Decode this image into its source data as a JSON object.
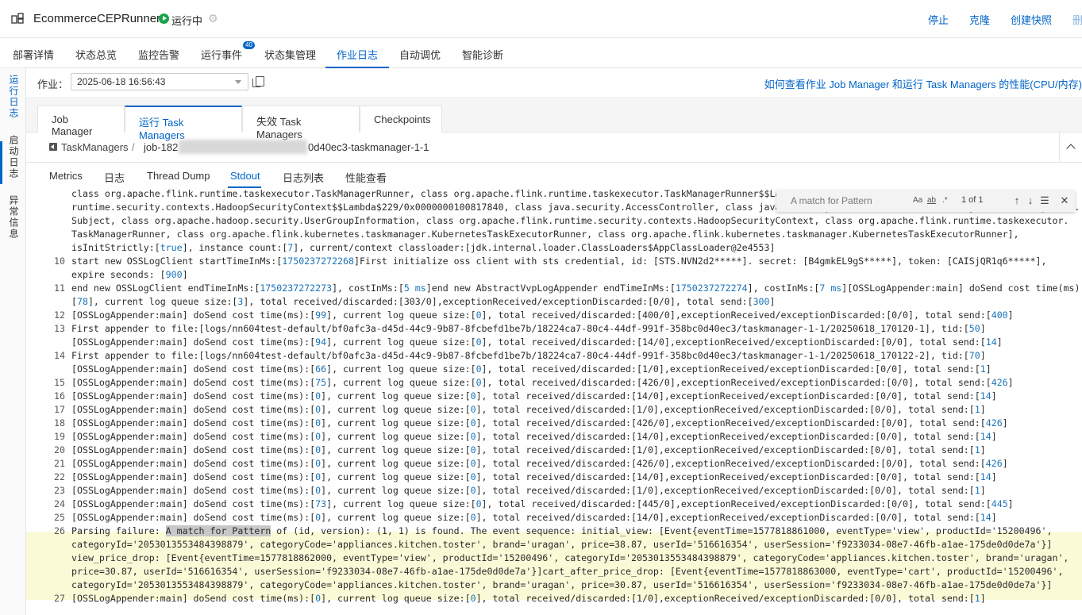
{
  "header": {
    "app_title": "EcommerceCEPRunner4",
    "status": "运行中",
    "actions": [
      "停止",
      "克隆",
      "创建快照",
      "删除"
    ]
  },
  "main_tabs": [
    {
      "label": "部署详情"
    },
    {
      "label": "状态总览"
    },
    {
      "label": "监控告警"
    },
    {
      "label": "运行事件",
      "badge": "40"
    },
    {
      "label": "状态集管理"
    },
    {
      "label": "作业日志",
      "active": true
    },
    {
      "label": "自动调优"
    },
    {
      "label": "智能诊断"
    }
  ],
  "left_nav": [
    {
      "label": "运行日志",
      "active": true
    },
    {
      "label": "启动日志"
    },
    {
      "label": "异常信息"
    }
  ],
  "job": {
    "label": "作业：",
    "selected": "2025-06-18 16:56:43",
    "help_link": "如何查看作业 Job Manager 和运行 Task Managers 的性能(CPU/内存)"
  },
  "sub_tabs": [
    "Job Manager",
    "运行 Task Managers",
    "失效 Task Managers",
    "Checkpoints"
  ],
  "breadcrumb": {
    "root": "TaskManagers",
    "separator": "/",
    "job_prefix": "job-182",
    "job_suffix": "0d40ec3-taskmanager-1-1"
  },
  "inner_tabs": [
    "Metrics",
    "日志",
    "Thread Dump",
    "Stdout",
    "日志列表",
    "性能查看"
  ],
  "find_widget": {
    "query": "A match for Pattern",
    "options": [
      "Aa",
      "ab",
      ".*"
    ],
    "count": "1 of 1"
  },
  "log_lines": [
    {
      "ln": "",
      "text": "class org.apache.flink.runtime.taskexecutor.TaskManagerRunner, class org.apache.flink.runtime.taskexecutor.TaskManagerRunner$$La"
    },
    {
      "ln": "",
      "text": "runtime.security.contexts.HadoopSecurityContext$$Lambda$229/0x0000000100817840, class java.security.AccessController, class java.security.AccessController, class javax.security.auth."
    },
    {
      "ln": "",
      "text": "Subject, class org.apache.hadoop.security.UserGroupInformation, class org.apache.flink.runtime.security.contexts.HadoopSecurityContext, class org.apache.flink.runtime.taskexecutor."
    },
    {
      "ln": "",
      "text": "TaskManagerRunner, class org.apache.flink.kubernetes.taskmanager.KubernetesTaskExecutorRunner, class org.apache.flink.kubernetes.taskmanager.KubernetesTaskExecutorRunner],"
    },
    {
      "ln": "",
      "text": "isInitStrictly:[true], instance count:[7], current/context classloader:[jdk.internal.loader.ClassLoaders$AppClassLoader@2e4553]"
    },
    {
      "ln": "10",
      "text": "start new OSSLogClient startTimeInMs:[1750237272268]First initialize oss client with sts credential, id: [STS.NVN2d2*****]. secret: [B4gmkEL9gS*****], token: [CAISjQR1q6*****],"
    },
    {
      "ln": "",
      "text": "expire seconds: [900]"
    },
    {
      "ln": "11",
      "text": "end new OSSLogClient endTimeInMs:[1750237272273], costInMs:[5 ms]end new AbstractVvpLogAppender endTimeInMs:[1750237272274], costInMs:[7 ms][OSSLogAppender:main] doSend cost time(ms):"
    },
    {
      "ln": "",
      "text": "[78], current log queue size:[3], total received/discarded:[303/0],exceptionReceived/exceptionDiscarded:[0/0], total send:[300]"
    },
    {
      "ln": "12",
      "text": "[OSSLogAppender:main] doSend cost time(ms):[99], current log queue size:[0], total received/discarded:[400/0],exceptionReceived/exceptionDiscarded:[0/0], total send:[400]"
    },
    {
      "ln": "13",
      "text": "First appender to file:[logs/nn604test-default/bf0afc3a-d45d-44c9-9b87-8fcbefd1be7b/18224ca7-80c4-44df-991f-358bc0d40ec3/taskmanager-1-1/20250618_170120-1], tid:[50]"
    },
    {
      "ln": "",
      "text": "[OSSLogAppender:main] doSend cost time(ms):[94], current log queue size:[0], total received/discarded:[14/0],exceptionReceived/exceptionDiscarded:[0/0], total send:[14]"
    },
    {
      "ln": "14",
      "text": "First appender to file:[logs/nn604test-default/bf0afc3a-d45d-44c9-9b87-8fcbefd1be7b/18224ca7-80c4-44df-991f-358bc0d40ec3/taskmanager-1-1/20250618_170122-2], tid:[70]"
    },
    {
      "ln": "",
      "text": "[OSSLogAppender:main] doSend cost time(ms):[66], current log queue size:[0], total received/discarded:[1/0],exceptionReceived/exceptionDiscarded:[0/0], total send:[1]"
    },
    {
      "ln": "15",
      "text": "[OSSLogAppender:main] doSend cost time(ms):[75], current log queue size:[0], total received/discarded:[426/0],exceptionReceived/exceptionDiscarded:[0/0], total send:[426]"
    },
    {
      "ln": "16",
      "text": "[OSSLogAppender:main] doSend cost time(ms):[0], current log queue size:[0], total received/discarded:[14/0],exceptionReceived/exceptionDiscarded:[0/0], total send:[14]"
    },
    {
      "ln": "17",
      "text": "[OSSLogAppender:main] doSend cost time(ms):[0], current log queue size:[0], total received/discarded:[1/0],exceptionReceived/exceptionDiscarded:[0/0], total send:[1]"
    },
    {
      "ln": "18",
      "text": "[OSSLogAppender:main] doSend cost time(ms):[0], current log queue size:[0], total received/discarded:[426/0],exceptionReceived/exceptionDiscarded:[0/0], total send:[426]"
    },
    {
      "ln": "19",
      "text": "[OSSLogAppender:main] doSend cost time(ms):[0], current log queue size:[0], total received/discarded:[14/0],exceptionReceived/exceptionDiscarded:[0/0], total send:[14]"
    },
    {
      "ln": "20",
      "text": "[OSSLogAppender:main] doSend cost time(ms):[0], current log queue size:[0], total received/discarded:[1/0],exceptionReceived/exceptionDiscarded:[0/0], total send:[1]"
    },
    {
      "ln": "21",
      "text": "[OSSLogAppender:main] doSend cost time(ms):[0], current log queue size:[0], total received/discarded:[426/0],exceptionReceived/exceptionDiscarded:[0/0], total send:[426]"
    },
    {
      "ln": "22",
      "text": "[OSSLogAppender:main] doSend cost time(ms):[0], current log queue size:[0], total received/discarded:[14/0],exceptionReceived/exceptionDiscarded:[0/0], total send:[14]"
    },
    {
      "ln": "23",
      "text": "[OSSLogAppender:main] doSend cost time(ms):[0], current log queue size:[0], total received/discarded:[1/0],exceptionReceived/exceptionDiscarded:[0/0], total send:[1]"
    },
    {
      "ln": "24",
      "text": "[OSSLogAppender:main] doSend cost time(ms):[73], current log queue size:[0], total received/discarded:[445/0],exceptionReceived/exceptionDiscarded:[0/0], total send:[445]"
    },
    {
      "ln": "25",
      "text": "[OSSLogAppender:main] doSend cost time(ms):[0], current log queue size:[0], total received/discarded:[14/0],exceptionReceived/exceptionDiscarded:[0/0], total send:[14]"
    },
    {
      "ln": "26",
      "text": "Parsing failure: A match for Pattern of (id, version): (1, 1) is found. The event sequence: initial_view: [Event{eventTime=1577818861000, eventType='view', productId='15200496',",
      "highlight": true,
      "match": "A match for Pattern"
    },
    {
      "ln": "",
      "text": "categoryId='2053013553484398879', categoryCode='appliances.kitchen.toster', brand='uragan', price=38.87, userId='516616354', userSession='f9233034-08e7-46fb-a1ae-175de0d0de7a'}]",
      "highlight": true
    },
    {
      "ln": "",
      "text": "view_price_drop: [Event{eventTime=1577818862000, eventType='view', productId='15200496', categoryId='2053013553484398879', categoryCode='appliances.kitchen.toster', brand='uragan',",
      "highlight": true
    },
    {
      "ln": "",
      "text": "price=30.87, userId='516616354', userSession='f9233034-08e7-46fb-a1ae-175de0d0de7a'}]cart_after_price_drop: [Event{eventTime=1577818863000, eventType='cart', productId='15200496',",
      "highlight": true
    },
    {
      "ln": "",
      "text": "categoryId='2053013553484398879', categoryCode='appliances.kitchen.toster', brand='uragan', price=30.87, userId='516616354', userSession='f9233034-08e7-46fb-a1ae-175de0d0de7a'}]",
      "highlight": true
    },
    {
      "ln": "27",
      "text": "[OSSLogAppender:main] doSend cost time(ms):[0], current log queue size:[0], total received/discarded:[1/0],exceptionReceived/exceptionDiscarded:[0/0], total send:[1]"
    }
  ],
  "colors": {
    "accent": "#0064c8",
    "running": "#1aa34a",
    "highlight_bg": "#fbfad7"
  }
}
